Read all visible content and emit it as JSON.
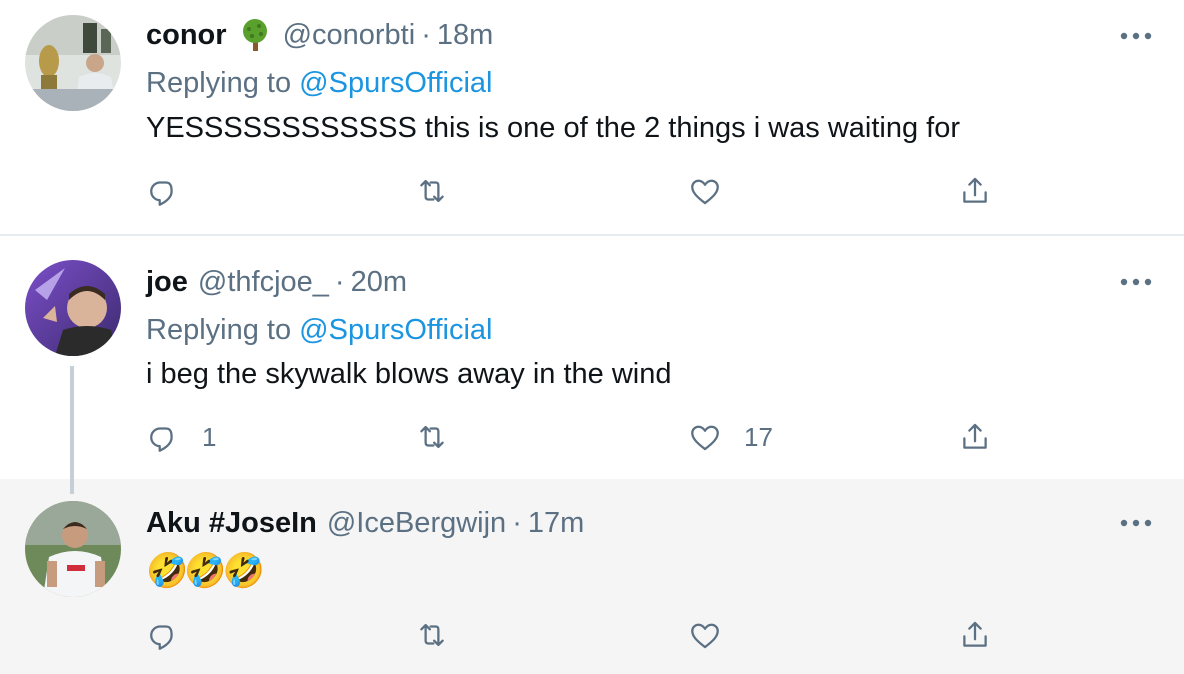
{
  "tweets": [
    {
      "name": "conor",
      "name_emoji": "deciduous-tree-icon",
      "handle": "@conorbti",
      "separator": "·",
      "time": "18m",
      "replying_prefix": "Replying to",
      "replying_to": "@SpursOfficial",
      "text": "YESSSSSSSSSSSS this is one of the 2 things i was waiting for",
      "reply_count": "",
      "retweet_count": "",
      "like_count": ""
    },
    {
      "name": "joe",
      "handle": "@thfcjoe_",
      "separator": "·",
      "time": "20m",
      "replying_prefix": "Replying to",
      "replying_to": "@SpursOfficial",
      "text": "i beg the skywalk blows away in the wind",
      "reply_count": "1",
      "retweet_count": "",
      "like_count": "17"
    },
    {
      "name": "Aku #JoseIn",
      "handle": "@IceBergwijn",
      "separator": "·",
      "time": "17m",
      "text": "🤣🤣🤣",
      "reply_count": "",
      "retweet_count": "",
      "like_count": ""
    }
  ],
  "colors": {
    "text": "#0f1419",
    "muted": "#5b7083",
    "link": "#1b95e0",
    "highlight_bg": "#f5f5f5"
  }
}
